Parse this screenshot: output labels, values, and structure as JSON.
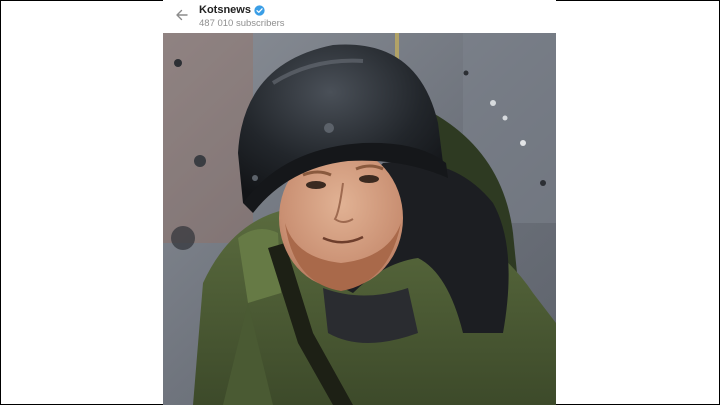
{
  "channel": {
    "name": "Kotsnews",
    "subscribers": "487 010 subscribers",
    "verified": true
  },
  "icons": {
    "back": "arrow-left-icon",
    "verified": "verified-check-icon"
  },
  "colors": {
    "verified_badge": "#3a9ee6",
    "subscriber_text": "#8f8f8f"
  }
}
